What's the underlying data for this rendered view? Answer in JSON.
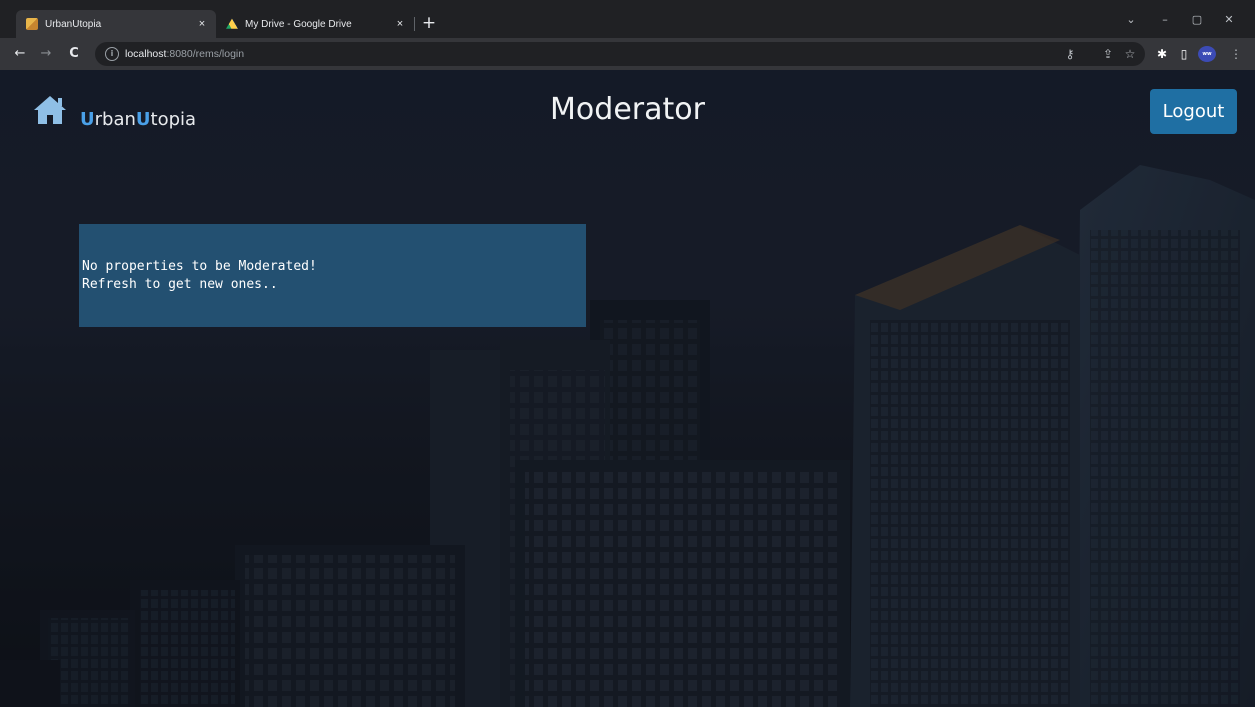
{
  "browser": {
    "tabs": [
      {
        "title": "UrbanUtopia",
        "close": "×",
        "favicon": "house-favicon"
      },
      {
        "title": "My Drive - Google Drive",
        "close": "×",
        "favicon": "google-drive-favicon"
      }
    ],
    "new_tab": "+",
    "window_controls": {
      "dropdown": "⌄",
      "minimize": "–",
      "maximize": "▢",
      "close": "✕"
    },
    "toolbar": {
      "back": "←",
      "forward": "→",
      "reload": "C",
      "site_info": "i"
    },
    "address": {
      "host": "localhost",
      "path": ":8080/rems/login"
    },
    "toolbar_icons": {
      "key": "⚷",
      "share": "⇪",
      "bookmark": "☆",
      "extensions": "✱",
      "side_panel": "▯",
      "menu": "⋮"
    },
    "profile_label": "ww"
  },
  "app": {
    "brand": {
      "u1": "U",
      "part1": "rban",
      "u2": "U",
      "part2": "topia"
    },
    "page_title": "Moderator",
    "logout_label": "Logout",
    "notice": {
      "line1": "No properties to be Moderated!",
      "line2": "Refresh to get new ones.."
    }
  },
  "colors": {
    "accent": "#4aa0e8",
    "logout_button": "#1f6fa3",
    "notice_panel": "#285f87"
  }
}
